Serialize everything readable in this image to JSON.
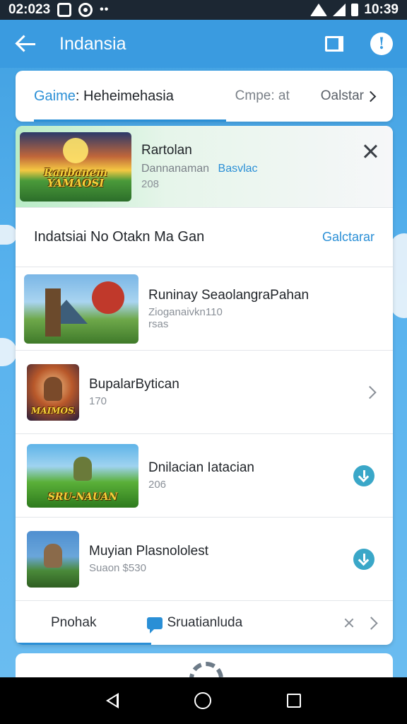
{
  "status_bar": {
    "time_left": "02:023",
    "time_right": "10:39"
  },
  "app_bar": {
    "title": "Indansia"
  },
  "top_tabs": {
    "active_prefix": "Gaime",
    "active_rest": ": Heheimehasia",
    "tab_2": "Cmpe: at",
    "tab_3": "Oalstar"
  },
  "featured": {
    "thumb_label": "Ranbanem YAMAOSI",
    "title": "Rartolan",
    "subtitle": "Dannanaman",
    "link": "Basvlac",
    "meta": "208"
  },
  "section": {
    "title": "Indatsiai No Otakn Ma Gan",
    "link": "Galctarar"
  },
  "games": [
    {
      "title": "Runinay SeaolangraPahan",
      "line2": "Zioganaivkn110",
      "line3": "rsas"
    },
    {
      "title": "BupalarBytican",
      "meta": "170",
      "thumb_label": "MAIMOSE"
    },
    {
      "title": "Dnilacian Iatacian",
      "meta": "206",
      "thumb_label": "SRU-NAUAN"
    },
    {
      "title": "Muyian Plasnololest",
      "meta": "Suaon  $530"
    }
  ],
  "bottom_tabs": {
    "item_1": "Pnohak",
    "item_2": "Sruatianluda"
  },
  "colors": {
    "accent": "#2a8fd6",
    "app_bar": "#3a9be0",
    "download": "#3aa7c8"
  },
  "icons": [
    "back-arrow-icon",
    "flag-icon",
    "info-icon",
    "chevron-right-icon",
    "close-icon",
    "download-icon",
    "chat-icon",
    "gear-icon"
  ]
}
